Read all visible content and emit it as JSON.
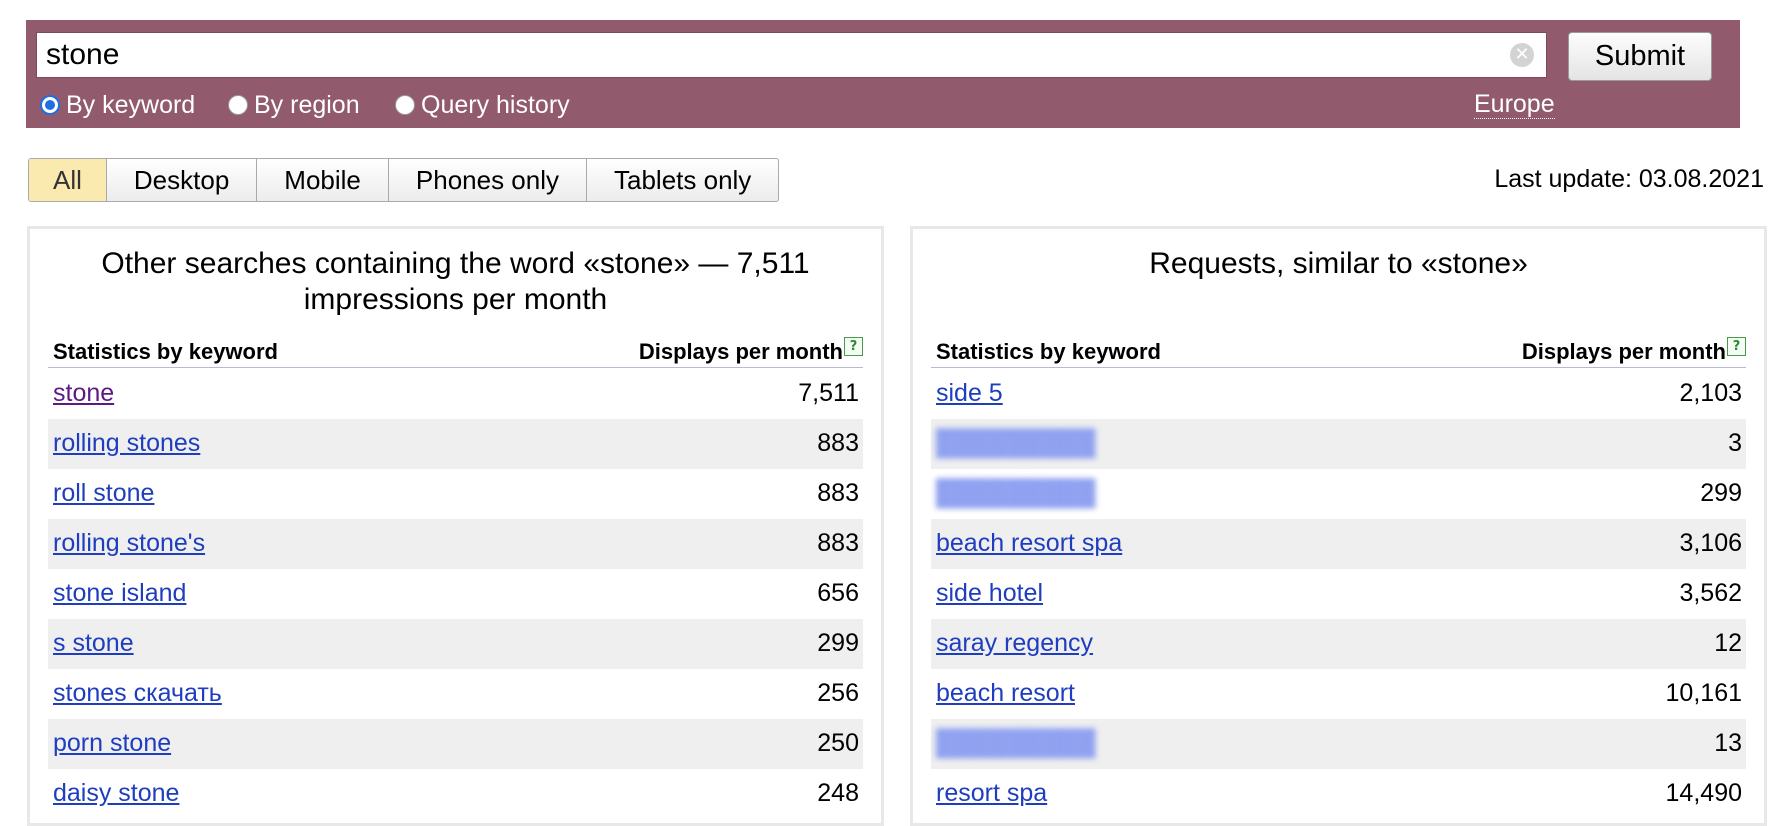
{
  "search": {
    "query": "stone",
    "submit_label": "Submit",
    "clear_icon": "✕",
    "modes": [
      {
        "label": "By keyword",
        "checked": true
      },
      {
        "label": "By region",
        "checked": false
      },
      {
        "label": "Query history",
        "checked": false
      }
    ],
    "region": "Europe"
  },
  "device_tabs": [
    {
      "label": "All",
      "active": true
    },
    {
      "label": "Desktop",
      "active": false
    },
    {
      "label": "Mobile",
      "active": false
    },
    {
      "label": "Phones only",
      "active": false
    },
    {
      "label": "Tablets only",
      "active": false
    }
  ],
  "last_update": "Last update: 03.08.2021",
  "left_panel": {
    "title": "Other searches containing the word «stone» — 7,511 impressions per month",
    "col_keyword": "Statistics by keyword",
    "col_displays": "Displays per month",
    "help_icon": "?",
    "rows": [
      {
        "keyword": "stone",
        "count": "7,511",
        "visited": true
      },
      {
        "keyword": "rolling stones",
        "count": "883"
      },
      {
        "keyword": "roll stone",
        "count": "883"
      },
      {
        "keyword": "rolling stone's",
        "count": "883"
      },
      {
        "keyword": "stone island",
        "count": "656"
      },
      {
        "keyword": "s stone",
        "count": "299"
      },
      {
        "keyword": "stones скачать",
        "count": "256"
      },
      {
        "keyword": "porn stone",
        "count": "250"
      },
      {
        "keyword": "daisy stone",
        "count": "248"
      }
    ]
  },
  "right_panel": {
    "title": "Requests, similar to «stone»",
    "col_keyword": "Statistics by keyword",
    "col_displays": "Displays per month",
    "help_icon": "?",
    "rows": [
      {
        "keyword": "side 5",
        "count": "2,103"
      },
      {
        "keyword": "",
        "count": "3",
        "blurred": true
      },
      {
        "keyword": "",
        "count": "299",
        "blurred": true
      },
      {
        "keyword": "beach resort spa",
        "count": "3,106"
      },
      {
        "keyword": "side hotel",
        "count": "3,562"
      },
      {
        "keyword": "saray regency",
        "count": "12"
      },
      {
        "keyword": "beach resort",
        "count": "10,161"
      },
      {
        "keyword": "",
        "count": "13",
        "blurred": true
      },
      {
        "keyword": "resort spa",
        "count": "14,490"
      }
    ]
  },
  "colors": {
    "header_bg": "#925a6d",
    "link": "#1e3dbf",
    "visited_link": "#5b1a86",
    "active_tab": "#fbeab0",
    "row_alt": "#efefef"
  }
}
